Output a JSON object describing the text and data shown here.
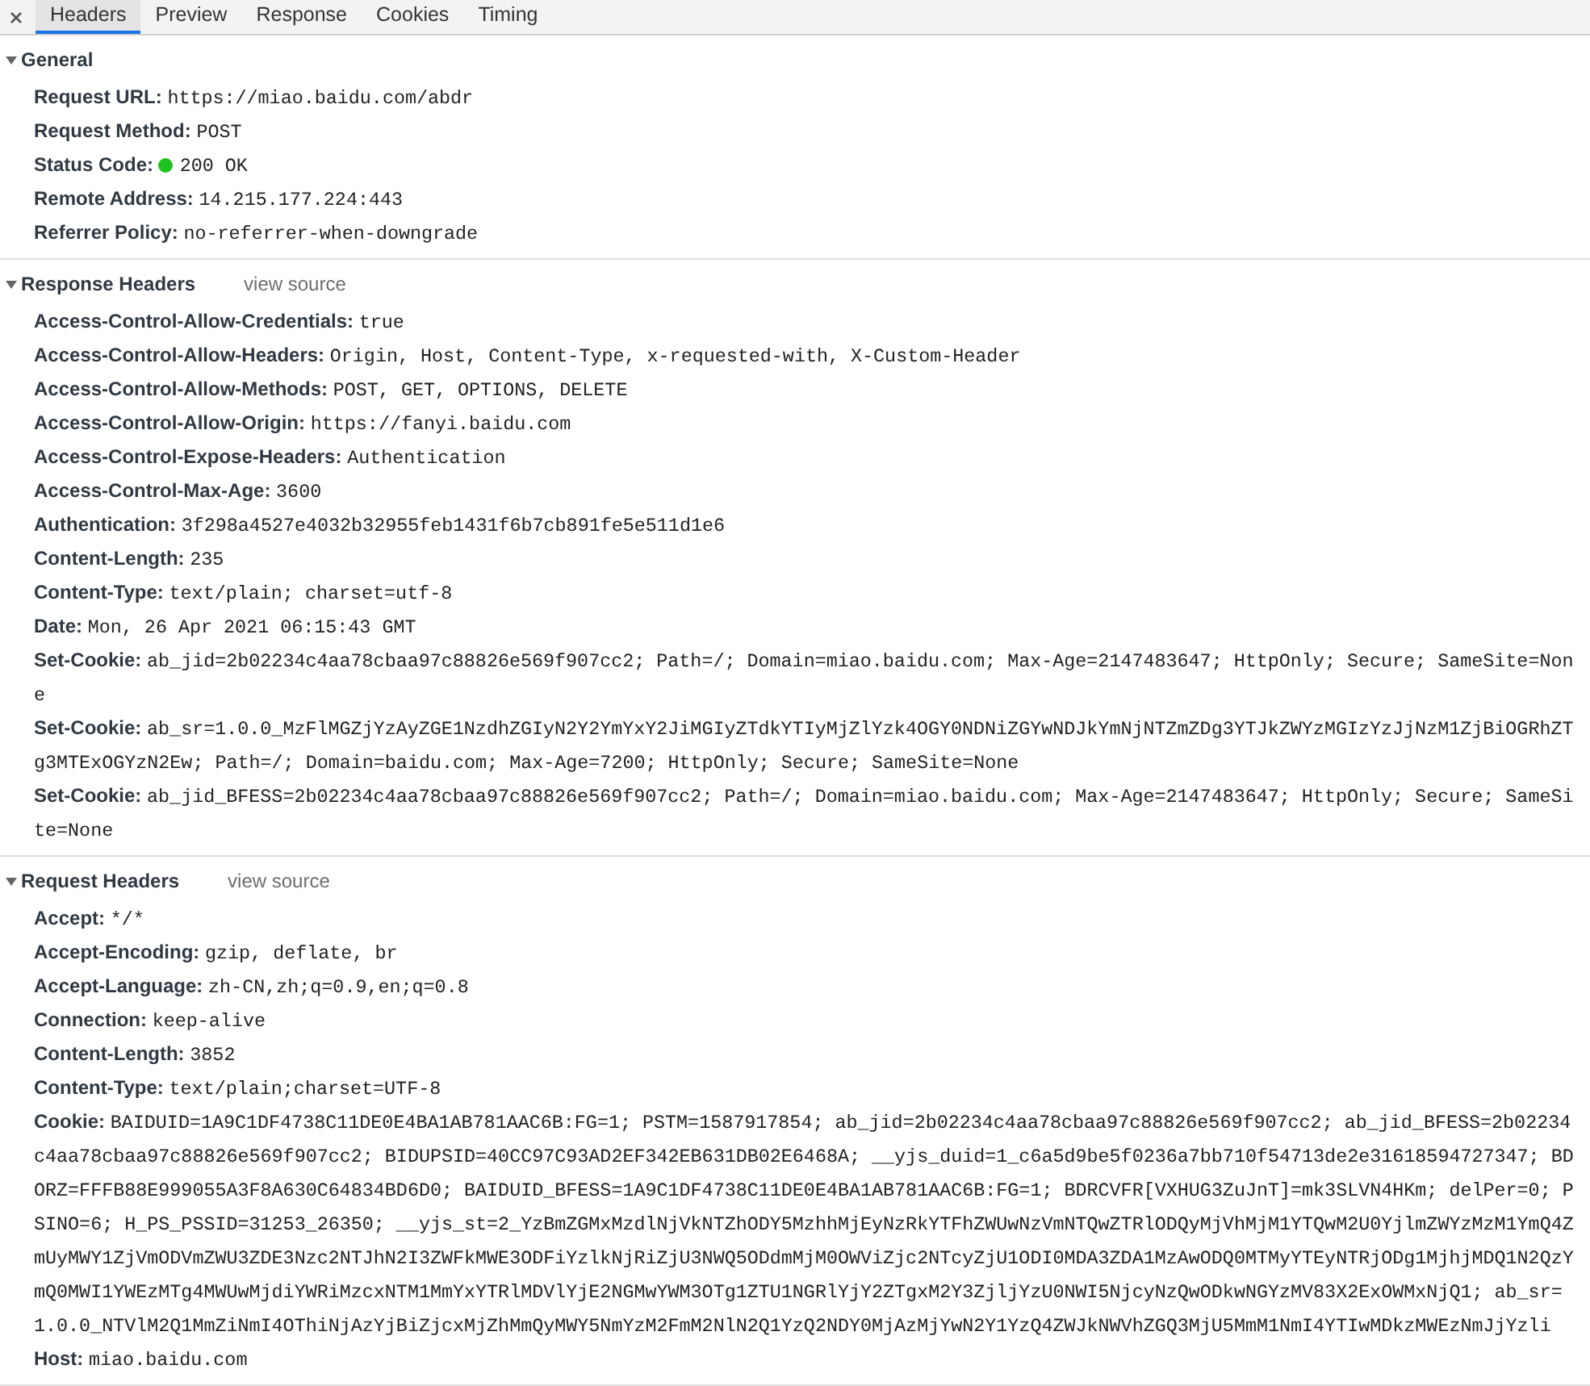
{
  "tabs": [
    {
      "label": "Headers",
      "selected": true
    },
    {
      "label": "Preview",
      "selected": false
    },
    {
      "label": "Response",
      "selected": false
    },
    {
      "label": "Cookies",
      "selected": false
    },
    {
      "label": "Timing",
      "selected": false
    }
  ],
  "sections": [
    {
      "title": "General",
      "expanded": true,
      "rows": [
        {
          "name": "Request URL:",
          "value": "https://miao.baidu.com/abdr",
          "kind": "plain"
        },
        {
          "name": "Request Method:",
          "value": "POST",
          "kind": "plain"
        },
        {
          "name": "Status Code:",
          "value": "200 OK",
          "kind": "status"
        },
        {
          "name": "Remote Address:",
          "value": "14.215.177.224:443",
          "kind": "plain"
        },
        {
          "name": "Referrer Policy:",
          "value": "no-referrer-when-downgrade",
          "kind": "plain"
        }
      ]
    },
    {
      "title": "Response Headers",
      "link": "view source",
      "expanded": true,
      "rows": [
        {
          "name": "Access-Control-Allow-Credentials:",
          "value": "true",
          "kind": "plain"
        },
        {
          "name": "Access-Control-Allow-Headers:",
          "value": "Origin, Host, Content-Type, x-requested-with, X-Custom-Header",
          "kind": "plain"
        },
        {
          "name": "Access-Control-Allow-Methods:",
          "value": "POST, GET, OPTIONS, DELETE",
          "kind": "plain"
        },
        {
          "name": "Access-Control-Allow-Origin:",
          "value": "https://fanyi.baidu.com",
          "kind": "plain"
        },
        {
          "name": "Access-Control-Expose-Headers:",
          "value": "Authentication",
          "kind": "plain"
        },
        {
          "name": "Access-Control-Max-Age:",
          "value": "3600",
          "kind": "plain"
        },
        {
          "name": "Authentication:",
          "value": "3f298a4527e4032b32955feb1431f6b7cb891fe5e511d1e6",
          "kind": "plain"
        },
        {
          "name": "Content-Length:",
          "value": "235",
          "kind": "plain"
        },
        {
          "name": "Content-Type:",
          "value": "text/plain; charset=utf-8",
          "kind": "plain"
        },
        {
          "name": "Date:",
          "value": "Mon, 26 Apr 2021 06:15:43 GMT",
          "kind": "plain"
        },
        {
          "name": "Set-Cookie:",
          "value": "ab_jid=2b02234c4aa78cbaa97c88826e569f907cc2; Path=/; Domain=miao.baidu.com; Max-Age=2147483647; HttpOnly; Secure; SameSite=None",
          "kind": "plain"
        },
        {
          "name": "Set-Cookie:",
          "value": "ab_sr=1.0.0_MzFlMGZjYzAyZGE1NzdhZGIyN2Y2YmYxY2JiMGIyZTdkYTIyMjZlYzk4OGY0NDNiZGYwNDJkYmNjNTZmZDg3YTJkZWYzMGIzYzJjNzM1ZjBiOGRhZTg3MTExOGYzN2Ew; Path=/; Domain=baidu.com; Max-Age=7200; HttpOnly; Secure; SameSite=None",
          "kind": "plain"
        },
        {
          "name": "Set-Cookie:",
          "value": "ab_jid_BFESS=2b02234c4aa78cbaa97c88826e569f907cc2; Path=/; Domain=miao.baidu.com; Max-Age=2147483647; HttpOnly; Secure; SameSite=None",
          "kind": "plain"
        }
      ]
    },
    {
      "title": "Request Headers",
      "link": "view source",
      "expanded": true,
      "rows": [
        {
          "name": "Accept:",
          "value": "*/*",
          "kind": "plain"
        },
        {
          "name": "Accept-Encoding:",
          "value": "gzip, deflate, br",
          "kind": "plain"
        },
        {
          "name": "Accept-Language:",
          "value": "zh-CN,zh;q=0.9,en;q=0.8",
          "kind": "plain"
        },
        {
          "name": "Connection:",
          "value": "keep-alive",
          "kind": "plain"
        },
        {
          "name": "Content-Length:",
          "value": "3852",
          "kind": "plain"
        },
        {
          "name": "Content-Type:",
          "value": "text/plain;charset=UTF-8",
          "kind": "plain"
        },
        {
          "name": "Cookie:",
          "value": "BAIDUID=1A9C1DF4738C11DE0E4BA1AB781AAC6B:FG=1; PSTM=1587917854; ab_jid=2b02234c4aa78cbaa97c88826e569f907cc2; ab_jid_BFESS=2b02234c4aa78cbaa97c88826e569f907cc2; BIDUPSID=40CC97C93AD2EF342EB631DB02E6468A; __yjs_duid=1_c6a5d9be5f0236a7bb710f54713de2e31618594727347; BDORZ=FFFB88E999055A3F8A630C64834BD6D0; BAIDUID_BFESS=1A9C1DF4738C11DE0E4BA1AB781AAC6B:FG=1; BDRCVFR[VXHUG3ZuJnT]=mk3SLVN4HKm; delPer=0; PSINO=6; H_PS_PSSID=31253_26350; __yjs_st=2_YzBmZGMxMzdlNjVkNTZhODY5MzhhMjEyNzRkYTFhZWUwNzVmNTQwZTRlODQyMjVhMjM1YTQwM2U0YjlmZWYzMzM1YmQ4ZmUyMWY1ZjVmODVmZWU3ZDE3Nzc2NTJhN2I3ZWFkMWE3ODFiYzlkNjRiZjU3NWQ5ODdmMjM0OWViZjc2NTcyZjU1ODI0MDA3ZDA1MzAwODQ0MTMyYTEyNTRjODg1MjhjMDQ1N2QzYmQ0MWI1YWEzMTg4MWUwMjdiYWRiMzcxNTM1MmYxYTRlMDVlYjE2NGMwYWM3OTg1ZTU1NGRlYjY2ZTgxM2Y3ZjljYzU0NWI5NjcyNzQwODkwNGYzMV83X2ExOWMxNjQ1; ab_sr=1.0.0_NTVlM2Q1MmZiNmI4OThiNjAzYjBiZjcxMjZhMmQyMWY5NmYzM2FmM2NlN2Q1YzQ2NDY0MjAzMjYwN2Y1YzQ4ZWJkNWVhZGQ3MjU5MmM1NmI4YTIwMDkzMWEzNmJjYzli",
          "kind": "plain"
        },
        {
          "name": "Host:",
          "value": "miao.baidu.com",
          "kind": "plain"
        }
      ]
    }
  ]
}
